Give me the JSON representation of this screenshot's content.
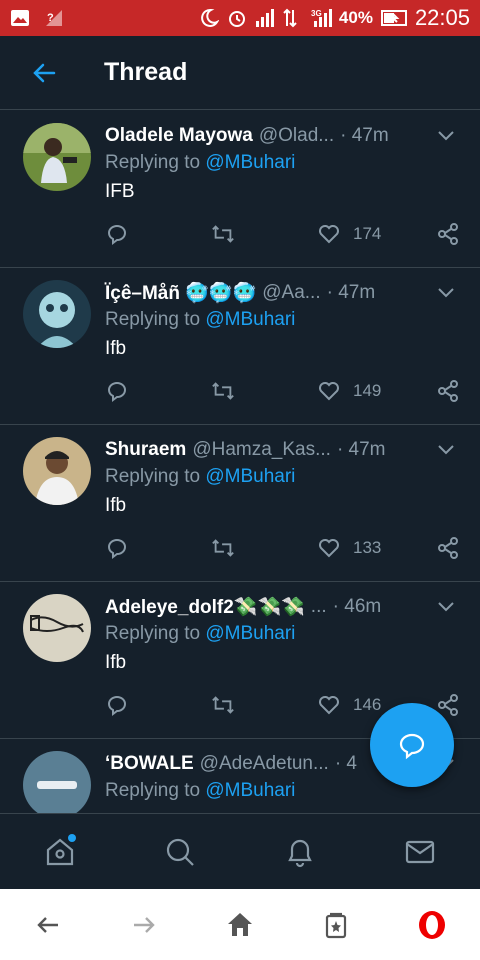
{
  "statusbar": {
    "battery": "40%",
    "time": "22:05",
    "network": "3G"
  },
  "header": {
    "title": "Thread"
  },
  "tweets": [
    {
      "name": "Oladele Mayowa",
      "handle": "@Olad...",
      "time": "· 47m",
      "reply_prefix": "Replying to ",
      "mention": "@MBuhari",
      "text": "IFB",
      "likes": "174"
    },
    {
      "name": "Ïçê–Måñ 🥶🥶🥶",
      "handle": "@Aa...",
      "time": "· 47m",
      "reply_prefix": "Replying to ",
      "mention": "@MBuhari",
      "text": "Ifb",
      "likes": "149"
    },
    {
      "name": "Shuraem",
      "handle": "@Hamza_Kas...",
      "time": "· 47m",
      "reply_prefix": "Replying to ",
      "mention": "@MBuhari",
      "text": "Ifb",
      "likes": "133"
    },
    {
      "name": "Adeleye_dolf2💸💸💸",
      "handle": "...",
      "time": "· 46m",
      "reply_prefix": "Replying to ",
      "mention": "@MBuhari",
      "text": "Ifb",
      "likes": "146"
    },
    {
      "name": "‘BOWALE",
      "handle": "@AdeAdetun...",
      "time": "· 4",
      "reply_prefix": "Replying to ",
      "mention": "@MBuhari",
      "text": "",
      "likes": ""
    }
  ],
  "colors": {
    "background": "#15202b",
    "accent": "#1da1f2",
    "muted": "#8899a6",
    "statusbar": "#c62828",
    "divider": "#38444d"
  },
  "icons": {
    "back": "arrow-left-icon",
    "caret": "chevron-down-icon",
    "reply": "comment-icon",
    "retweet": "retweet-icon",
    "like": "heart-icon",
    "share": "share-icon",
    "compose": "compose-reply-icon",
    "nav": [
      "home-icon",
      "search-icon",
      "bell-icon",
      "mail-icon"
    ],
    "browser": [
      "back-arrow-icon",
      "forward-arrow-icon",
      "home-icon",
      "tabs-icon",
      "opera-icon"
    ]
  }
}
